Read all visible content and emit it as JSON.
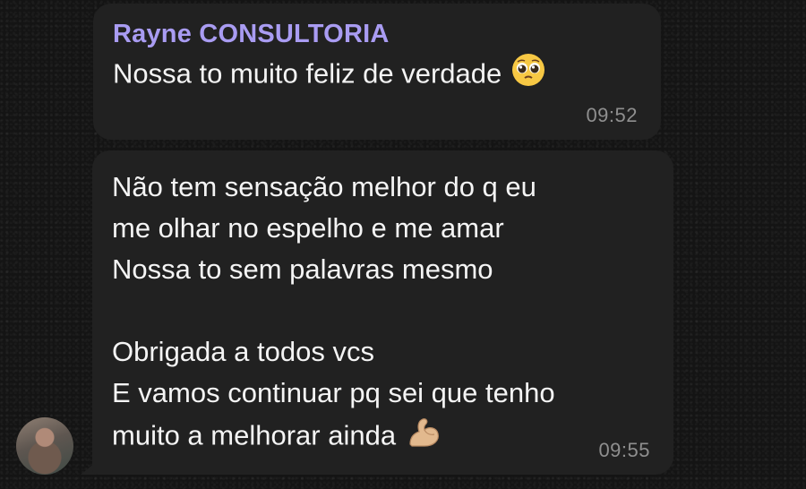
{
  "messages": [
    {
      "sender": "Rayne CONSULTORIA",
      "lines": [
        "Nossa to muito feliz de verdade"
      ],
      "emoji": "pleading-face-icon",
      "time": "09:52"
    },
    {
      "lines": [
        "Não tem sensação melhor do q eu",
        "me olhar no espelho e me amar",
        "Nossa to sem palavras mesmo",
        "",
        "Obrigada a todos vcs",
        "E vamos continuar pq sei que tenho",
        "muito a melhorar ainda"
      ],
      "emoji": "flexed-biceps-icon",
      "time": "09:55"
    }
  ],
  "colors": {
    "bubble": "#212121",
    "sender_name": "#a99cf2",
    "timestamp": "#8f8f8f"
  }
}
